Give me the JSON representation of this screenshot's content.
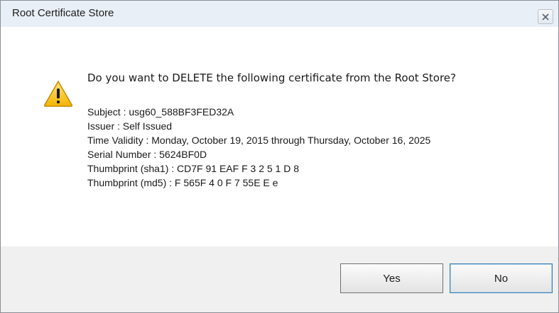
{
  "window": {
    "title": "Root Certificate Store",
    "close_icon": "close-icon"
  },
  "message": {
    "icon": "warning-icon",
    "question": "Do you want to DELETE the following certificate from the Root Store?",
    "subject": "Subject : usg60_588BF3FED32A",
    "issuer": "Issuer : Self Issued",
    "validity": "Time Validity : Monday, October 19, 2015 through Thursday, October 16, 2025",
    "serial": "Serial Number : 5624BF0D",
    "thumb_sha1": "Thumbprint (sha1) : CD7F     91   EAF  F       3 2  5   1     D    8",
    "thumb_md5": "Thumbprint (md5) : F  565F  4 0  F   7   55E  E      e"
  },
  "buttons": {
    "yes": "Yes",
    "no": "No"
  },
  "colors": {
    "titlebar": "#e9eff6",
    "footer": "#f0f0f0",
    "warning": "#f2c200"
  }
}
